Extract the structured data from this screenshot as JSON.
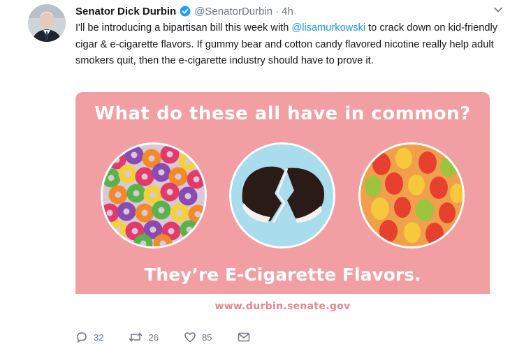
{
  "tweet": {
    "author": {
      "display_name": "Senator Dick Durbin",
      "handle": "@SenatorDurbin",
      "verified": true,
      "avatar_icon": "senator-portrait"
    },
    "separator": "·",
    "timestamp": "4h",
    "text": {
      "part1": "I'll be introducing a bipartisan bill this week with ",
      "mention": "@lisamurkowski",
      "part2": " to crack down on kid-friendly cigar & e-cigarette flavors. If gummy bear and cotton candy flavored nicotine really help adult smokers quit, then the e-cigarette industry should have to prove it."
    },
    "media": {
      "headline": "What do these all have in common?",
      "images": [
        "fruit-loops-cereal",
        "chocolate-cookie-snack",
        "gummy-bears"
      ],
      "tagline": "They’re E-Cigarette Flavors.",
      "url": "www.durbin.senate.gov",
      "background_color": "#f19fa3"
    },
    "actions": {
      "reply_count": "32",
      "retweet_count": "26",
      "like_count": "85",
      "reply_icon": "reply-icon",
      "retweet_icon": "retweet-icon",
      "like_icon": "heart-icon",
      "message_icon": "envelope-icon"
    }
  },
  "colors": {
    "link": "#1b95e0",
    "secondary_text": "#657786",
    "verified_badge": "#1da1f2"
  }
}
